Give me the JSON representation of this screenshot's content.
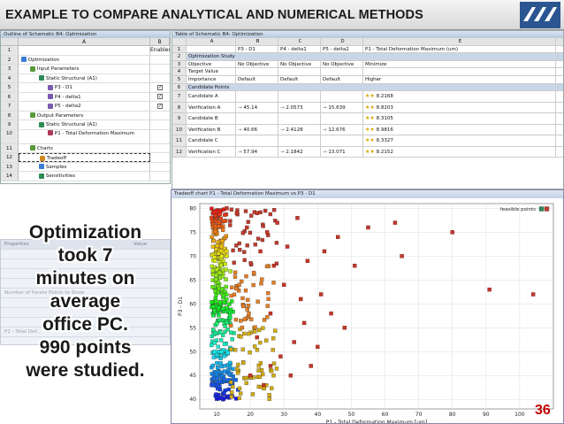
{
  "slide": {
    "title": "EXAMPLE TO COMPARE ANALYTICAL AND NUMERICAL METHODS",
    "page_number": "36",
    "big_text": [
      "Optimization",
      "took 7",
      "minutes on",
      "average",
      "office PC.",
      "990 points",
      "were studied."
    ]
  },
  "outline": {
    "caption": "Outline of Schematic B4: Optimization",
    "col_a": "A",
    "col_b": "B",
    "rows": [
      {
        "num": "1",
        "label": "",
        "b": "Enabled",
        "indent": 0,
        "icon": ""
      },
      {
        "num": "2",
        "label": "Optimization",
        "b": "",
        "indent": 0,
        "icon": "#3a7bd5"
      },
      {
        "num": "3",
        "label": "Input Parameters",
        "b": "",
        "indent": 1,
        "icon": "#5a9a3a"
      },
      {
        "num": "4",
        "label": "Static Structural (A1)",
        "b": "",
        "indent": 2,
        "icon": "#2e8b57"
      },
      {
        "num": "5",
        "label": "P3 - D1",
        "b": "✓",
        "indent": 3,
        "icon": "#7a5ab0"
      },
      {
        "num": "6",
        "label": "P4 - delta1",
        "b": "✓",
        "indent": 3,
        "icon": "#7a5ab0"
      },
      {
        "num": "7",
        "label": "P5 - delta2",
        "b": "✓",
        "indent": 3,
        "icon": "#7a5ab0"
      },
      {
        "num": "8",
        "label": "Output Parameters",
        "b": "",
        "indent": 1,
        "icon": "#5a9a3a"
      },
      {
        "num": "9",
        "label": "Static Structural (A1)",
        "b": "",
        "indent": 2,
        "icon": "#2e8b57"
      },
      {
        "num": "10",
        "label": "P1 - Total Deformation Maximum",
        "b": "",
        "indent": 3,
        "icon": "#b03a5a"
      },
      {
        "num": "11",
        "label": "Charts",
        "b": "",
        "indent": 1,
        "icon": "#5a9a3a"
      },
      {
        "num": "12",
        "label": "Tradeoff",
        "b": "",
        "indent": 2,
        "icon": "#d08a20"
      },
      {
        "num": "13",
        "label": "Samples",
        "b": "",
        "indent": 2,
        "icon": "#3a7bd5"
      },
      {
        "num": "14",
        "label": "Sensitivities",
        "b": "",
        "indent": 2,
        "icon": "#2e8b57"
      }
    ]
  },
  "table": {
    "caption": "Table of Schematic B4: Optimization",
    "headers": [
      "A",
      "B",
      "C",
      "D",
      "E"
    ],
    "row1": [
      "",
      "P3 - D1",
      "P4 - delta1",
      "P5 - delta2",
      "P1 - Total Deformation Maximum (um)"
    ],
    "row2": "Optimization Study",
    "objective": [
      "Objective",
      "No Objective",
      "No Objective",
      "No Objective",
      "Minimize"
    ],
    "target": [
      "Target Value",
      "",
      "",
      "",
      ""
    ],
    "importance": [
      "Importance",
      "Default",
      "Default",
      "Default",
      "Higher"
    ],
    "candidates_band": "Candidate Points",
    "candidates": [
      {
        "num": "7",
        "label": "Candidate A",
        "b": "",
        "c": "",
        "d": "",
        "e": "8.2168"
      },
      {
        "num": "8",
        "label": "Verification A",
        "b": "45.14",
        "c": "2.0573",
        "d": "15.639",
        "e": "8.8203"
      },
      {
        "num": "9",
        "label": "Candidate B",
        "b": "",
        "c": "",
        "d": "",
        "e": "8.3105"
      },
      {
        "num": "10",
        "label": "Verification B",
        "b": "40.66",
        "c": "2.4128",
        "d": "12.676",
        "e": "8.9816"
      },
      {
        "num": "11",
        "label": "Candidate C",
        "b": "",
        "c": "",
        "d": "",
        "e": "8.3327"
      },
      {
        "num": "12",
        "label": "Verification C",
        "b": "57.94",
        "c": "2.1842",
        "d": "13.071",
        "e": "8.2152"
      }
    ]
  },
  "properties": {
    "title": "Properties",
    "value_label": "Value",
    "rows": [
      "",
      "",
      "",
      "",
      "Number of Pareto Points to Show",
      "",
      "",
      "",
      "P1 - Total Def..."
    ]
  },
  "chart_data": {
    "type": "scatter",
    "title": "Tradeoff chart P1 - Total Deformation Maximum vs P3 - D1",
    "xlabel": "P1 - Total Deformation Maximum [um]",
    "ylabel": "P3 - D1",
    "xlim": [
      5,
      110
    ],
    "ylim": [
      38,
      81
    ],
    "xticks": [
      10,
      20,
      30,
      40,
      50,
      60,
      70,
      80,
      90,
      100
    ],
    "yticks": [
      40,
      45,
      50,
      55,
      60,
      65,
      70,
      75,
      80
    ],
    "legend": "feasible points",
    "legend_position": "top-right",
    "colormap": "green-red",
    "points_count": 990,
    "sparse_points": [
      [
        13,
        80
      ],
      [
        16,
        79
      ],
      [
        19,
        76
      ],
      [
        22,
        79
      ],
      [
        25,
        75
      ],
      [
        28,
        77
      ],
      [
        31,
        72
      ],
      [
        34,
        78
      ],
      [
        37,
        69
      ],
      [
        42,
        71
      ],
      [
        46,
        74
      ],
      [
        51,
        68
      ],
      [
        55,
        76
      ],
      [
        63,
        77
      ],
      [
        65,
        70
      ],
      [
        80,
        75
      ],
      [
        91,
        63
      ],
      [
        104,
        62
      ],
      [
        41,
        62
      ],
      [
        44,
        58
      ],
      [
        27,
        68
      ],
      [
        30,
        64
      ],
      [
        23,
        71
      ],
      [
        26,
        58
      ],
      [
        36,
        56
      ],
      [
        33,
        52
      ],
      [
        29,
        49
      ],
      [
        32,
        45
      ],
      [
        38,
        47
      ],
      [
        40,
        51
      ],
      [
        48,
        55
      ],
      [
        26,
        47
      ],
      [
        24,
        43
      ],
      [
        22,
        53
      ],
      [
        35,
        61
      ],
      [
        20,
        45
      ]
    ]
  }
}
